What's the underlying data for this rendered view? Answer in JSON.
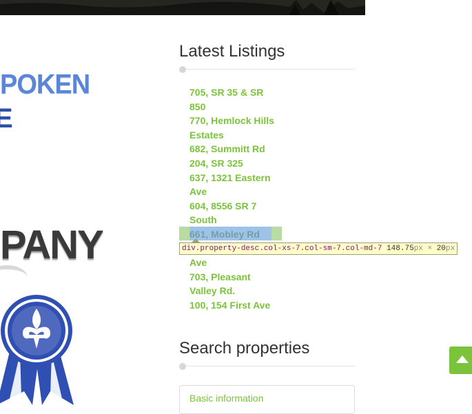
{
  "logo": {
    "top_text": "POKEN",
    "mid_text": "E",
    "company_text": "PANY"
  },
  "sidebar": {
    "listings_title": "Latest Listings",
    "listings": [
      "705, SR 35 & SR",
      "850",
      "770, Hemlock Hills",
      "Estates",
      "682, Summitt Rd",
      "204, SR 325",
      "637, 1321 Eastern",
      "Ave",
      "604, 8556 SR 7",
      "South",
      "661, Mobley Rd",
      "",
      "Ave",
      "703, Pleasant",
      "Valley Rd.",
      "100, 154 First Ave"
    ],
    "search_title": "Search properties",
    "search_basic_label": "Basic information"
  },
  "devtools": {
    "selector": "div.property-desc.col-xs-7.col-sm-7.col-md-7",
    "width_value": "148.75",
    "width_unit": "px",
    "times": "×",
    "height_value": "20",
    "height_unit": "px"
  },
  "colors": {
    "accent_green": "#7bc33a",
    "logo_blue": "#5b86d8",
    "highlight_content": "#9fc3e8",
    "highlight_padding": "#b9dca4"
  },
  "icons": {
    "scroll_top": "arrow-up-icon",
    "badge": "fleur-de-lis-ribbon-icon"
  }
}
